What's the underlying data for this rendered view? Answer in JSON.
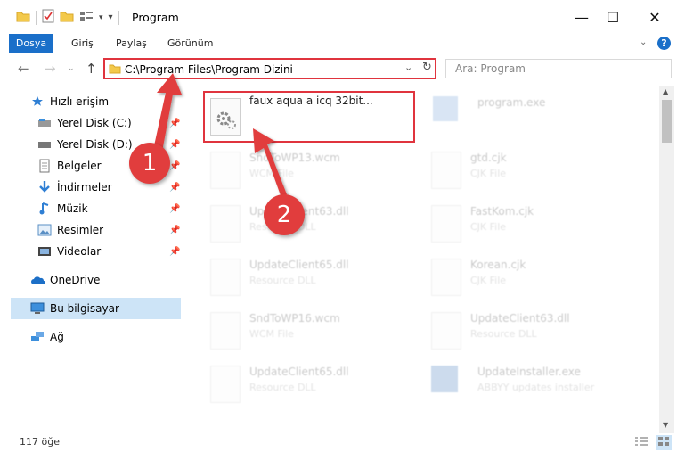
{
  "window": {
    "title": "Program",
    "minimize": "—",
    "maximize": "☐",
    "close": "✕"
  },
  "ribbon": {
    "tabs": [
      "Dosya",
      "Giriş",
      "Paylaş",
      "Görünüm"
    ],
    "help": "?"
  },
  "nav": {
    "address": "C:\\Program Files\\Program Dizini",
    "search_placeholder": "Ara: Program"
  },
  "sidebar": {
    "items": [
      {
        "label": "Hızlı erişim",
        "icon": "star-icon",
        "pinned": false
      },
      {
        "label": "Yerel Disk (C:)",
        "icon": "drive-icon",
        "pinned": true
      },
      {
        "label": "Yerel Disk (D:)",
        "icon": "drive-icon",
        "pinned": true
      },
      {
        "label": "Belgeler",
        "icon": "documents-icon",
        "pinned": true
      },
      {
        "label": "İndirmeler",
        "icon": "download-icon",
        "pinned": true
      },
      {
        "label": "Müzik",
        "icon": "music-icon",
        "pinned": true
      },
      {
        "label": "Resimler",
        "icon": "pictures-icon",
        "pinned": true
      },
      {
        "label": "Videolar",
        "icon": "videos-icon",
        "pinned": true
      },
      {
        "label": "OneDrive",
        "icon": "cloud-icon",
        "pinned": false
      },
      {
        "label": "Bu bilgisayar",
        "icon": "computer-icon",
        "pinned": false,
        "selected": true
      },
      {
        "label": "Ağ",
        "icon": "network-icon",
        "pinned": false
      }
    ]
  },
  "files": [
    {
      "name": "faux aqua a icq 32bit...",
      "type": "",
      "highlighted": true
    },
    {
      "name": "program.exe",
      "type": ""
    },
    {
      "name": "SndToWP13.wcm",
      "type": "WCM File"
    },
    {
      "name": "gtd.cjk",
      "type": "CJK File"
    },
    {
      "name": "UpdateClient63.dll",
      "type": "Resource DLL"
    },
    {
      "name": "FastKom.cjk",
      "type": "CJK File"
    },
    {
      "name": "UpdateClient65.dll",
      "type": "Resource DLL"
    },
    {
      "name": "Korean.cjk",
      "type": "CJK File"
    },
    {
      "name": "SndToWP16.wcm",
      "type": "WCM File"
    },
    {
      "name": "UpdateClient63.dll",
      "type": "Resource DLL"
    },
    {
      "name": "UpdateClient65.dll",
      "type": "Resource DLL"
    },
    {
      "name": "UpdateInstaller.exe",
      "type": "ABBYY updates installer"
    }
  ],
  "status": {
    "count": "117 öğe"
  },
  "annotations": {
    "step1": "1",
    "step2": "2",
    "color": "#e13d3d"
  }
}
